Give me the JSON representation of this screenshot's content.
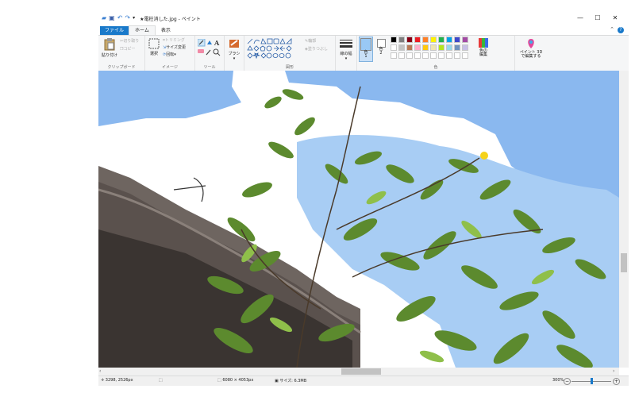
{
  "window": {
    "title": "★電柱消した.jpg - ペイント",
    "buttons": {
      "minimize": "—",
      "maximize": "☐",
      "close": "✕"
    }
  },
  "tabs": [
    {
      "label": "ファイル"
    },
    {
      "label": "ホーム"
    },
    {
      "label": "表示"
    }
  ],
  "ribbon": {
    "clipboard": {
      "paste": "貼り付け",
      "cut": "切り取り",
      "copy": "コピー",
      "label": "クリップボード"
    },
    "image": {
      "select": "選択",
      "crop": "トリミング",
      "resize": "サイズ変更",
      "rotate": "回転",
      "label": "イメージ"
    },
    "tools": {
      "label": "ツール",
      "brush": "ブラシ"
    },
    "shapes": {
      "outline": "輪郭",
      "fill": "塗りつぶし",
      "label": "図形"
    },
    "size": {
      "label": "線の幅"
    },
    "colors": {
      "color1": "色\n1",
      "color2": "色\n2",
      "edit": "色の\n編集",
      "label": "色",
      "palette_row1": [
        "#000000",
        "#7f7f7f",
        "#880015",
        "#ed1c24",
        "#ff7f27",
        "#fff200",
        "#22b14c",
        "#00a2e8",
        "#3f48cc",
        "#a349a4"
      ],
      "palette_row2": [
        "#ffffff",
        "#c3c3c3",
        "#b97a57",
        "#ffaec9",
        "#ffc90e",
        "#efe4b0",
        "#b5e61d",
        "#99d9ea",
        "#7092be",
        "#c8bfe7"
      ],
      "color1_value": "#99c8f5",
      "color2_value": "#ffffff"
    },
    "paint3d": {
      "label": "ペイント 3D\nで編集する"
    }
  },
  "status": {
    "cursor": "3298, 2526px",
    "dimensions": "6080 × 4053px",
    "filesize": "サイズ: 6.3MB",
    "zoom": "300%"
  }
}
